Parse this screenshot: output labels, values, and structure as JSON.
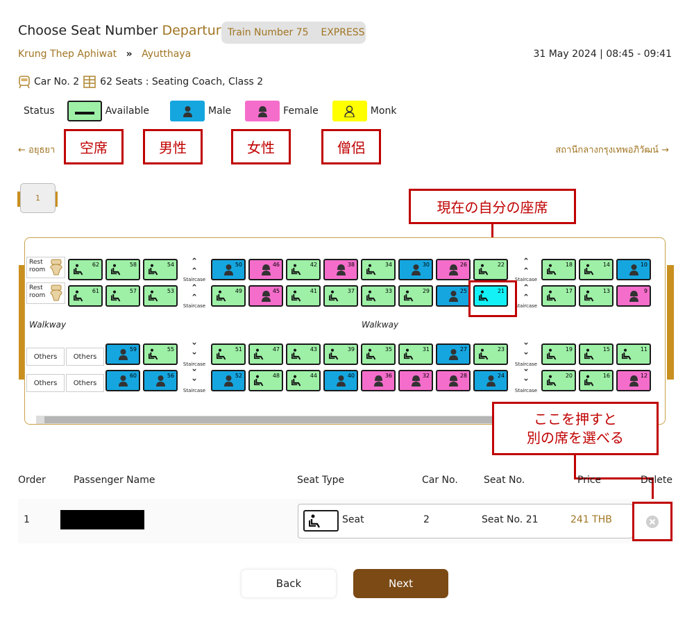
{
  "header": {
    "title_prefix": "Choose Seat Number",
    "title_direction": "Departure",
    "train_chip": "Train Number 75    EXPRESS",
    "origin": "Krung Thep Aphiwat",
    "route_arrow": "»",
    "destination": "Ayutthaya",
    "datetime": "31 May 2024 | 08:45 - 09:41"
  },
  "car_info": {
    "car": "Car No. 2",
    "seats": "62 Seats : Seating Coach, Class 2"
  },
  "legend": {
    "label": "Status",
    "available": "Available",
    "male": "Male",
    "female": "Female",
    "monk": "Monk",
    "colors": {
      "available": "#9df0a6",
      "male": "#15a6e0",
      "female": "#f56dcb",
      "monk": "#ffff00",
      "selected": "#13f1f7",
      "gold": "#a07523",
      "annotation": "#c00000"
    }
  },
  "annotations": {
    "available": "空席",
    "male": "男性",
    "female": "女性",
    "monk": "僧侶",
    "current_seat": "現在の自分の座席",
    "delete_hint": "ここを押すと\n別の席を選べる"
  },
  "nav": {
    "prev": "อยุธยา",
    "next": "สถานีกลางกรุงเทพอภิวัฒน์"
  },
  "pagination": {
    "current": "1"
  },
  "coach": {
    "rest_label": "Rest room",
    "others_label": "Others",
    "walkway_label": "Walkway",
    "staircase_label": "Staircase",
    "seats": [
      {
        "n": "62",
        "s": "available"
      },
      {
        "n": "58",
        "s": "available"
      },
      {
        "n": "54",
        "s": "available"
      },
      {
        "n": "50",
        "s": "male"
      },
      {
        "n": "46",
        "s": "female"
      },
      {
        "n": "42",
        "s": "available"
      },
      {
        "n": "38",
        "s": "female"
      },
      {
        "n": "34",
        "s": "available"
      },
      {
        "n": "30",
        "s": "male"
      },
      {
        "n": "26",
        "s": "female"
      },
      {
        "n": "22",
        "s": "available"
      },
      {
        "n": "18",
        "s": "available"
      },
      {
        "n": "14",
        "s": "available"
      },
      {
        "n": "10",
        "s": "male"
      },
      {
        "n": "61",
        "s": "available"
      },
      {
        "n": "57",
        "s": "available"
      },
      {
        "n": "53",
        "s": "available"
      },
      {
        "n": "49",
        "s": "available"
      },
      {
        "n": "45",
        "s": "female"
      },
      {
        "n": "41",
        "s": "available"
      },
      {
        "n": "37",
        "s": "available"
      },
      {
        "n": "33",
        "s": "available"
      },
      {
        "n": "29",
        "s": "available"
      },
      {
        "n": "25",
        "s": "male"
      },
      {
        "n": "21",
        "s": "selected"
      },
      {
        "n": "17",
        "s": "available"
      },
      {
        "n": "13",
        "s": "available"
      },
      {
        "n": "9",
        "s": "female"
      },
      {
        "n": "59",
        "s": "male"
      },
      {
        "n": "55",
        "s": "available"
      },
      {
        "n": "51",
        "s": "available"
      },
      {
        "n": "47",
        "s": "available"
      },
      {
        "n": "43",
        "s": "available"
      },
      {
        "n": "39",
        "s": "available"
      },
      {
        "n": "35",
        "s": "available"
      },
      {
        "n": "31",
        "s": "available"
      },
      {
        "n": "27",
        "s": "male"
      },
      {
        "n": "23",
        "s": "available"
      },
      {
        "n": "19",
        "s": "available"
      },
      {
        "n": "15",
        "s": "available"
      },
      {
        "n": "11",
        "s": "available"
      },
      {
        "n": "60",
        "s": "male"
      },
      {
        "n": "56",
        "s": "male"
      },
      {
        "n": "52",
        "s": "male"
      },
      {
        "n": "48",
        "s": "available"
      },
      {
        "n": "44",
        "s": "available"
      },
      {
        "n": "40",
        "s": "male"
      },
      {
        "n": "36",
        "s": "female"
      },
      {
        "n": "32",
        "s": "female"
      },
      {
        "n": "28",
        "s": "female"
      },
      {
        "n": "24",
        "s": "male"
      },
      {
        "n": "20",
        "s": "available"
      },
      {
        "n": "16",
        "s": "available"
      },
      {
        "n": "12",
        "s": "female"
      }
    ]
  },
  "table": {
    "headers": {
      "order": "Order",
      "name": "Passenger Name",
      "seat_type": "Seat Type",
      "car": "Car No.",
      "seat_no": "Seat No.",
      "price": "Price",
      "delete": "Delete"
    },
    "row": {
      "order": "1",
      "seat_type": "Seat",
      "car": "2",
      "seat_no": "Seat No. 21",
      "price": "241 THB"
    }
  },
  "buttons": {
    "back": "Back",
    "next": "Next"
  }
}
